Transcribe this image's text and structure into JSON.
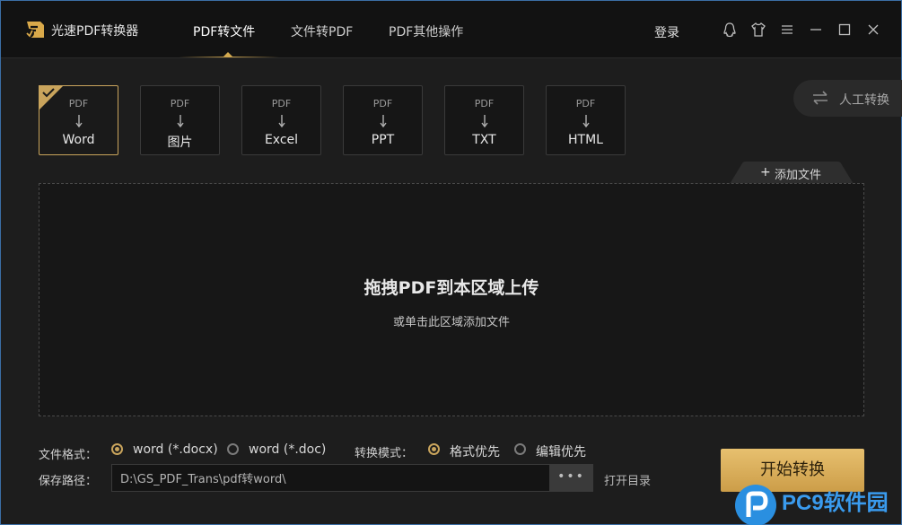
{
  "app": {
    "title": "光速PDF转换器",
    "login": "登录",
    "nav_tabs": [
      "PDF转文件",
      "文件转PDF",
      "PDF其他操作"
    ],
    "window_icons": [
      "qq-icon",
      "skin-icon",
      "menu-icon",
      "minimize-icon",
      "maximize-icon",
      "close-icon"
    ]
  },
  "formats": [
    {
      "from": "PDF",
      "to": "Word",
      "selected": true
    },
    {
      "from": "PDF",
      "to": "图片",
      "selected": false
    },
    {
      "from": "PDF",
      "to": "Excel",
      "selected": false
    },
    {
      "from": "PDF",
      "to": "PPT",
      "selected": false
    },
    {
      "from": "PDF",
      "to": "TXT",
      "selected": false
    },
    {
      "from": "PDF",
      "to": "HTML",
      "selected": false
    }
  ],
  "manual_convert": "人工转换",
  "add_file": "添加文件",
  "dropzone": {
    "title": "拖拽PDF到本区域上传",
    "subtitle": "或单击此区域添加文件"
  },
  "options": {
    "format_label": "文件格式：",
    "format_options": [
      "word (*.docx)",
      "word (*.doc)"
    ],
    "format_selected": "word (*.docx)",
    "mode_label": "转换模式：",
    "mode_options": [
      "格式优先",
      "编辑优先"
    ],
    "mode_selected": "格式优先",
    "save_label": "保存路径：",
    "save_path": "D:\\GS_PDF_Trans\\pdf转word\\",
    "browse": "•••",
    "open_dir": "打开目录"
  },
  "start_button": "开始转换",
  "watermark": "PC9软件园",
  "colors": {
    "accent_gold": "#c9a45c",
    "background": "#1d1d1d",
    "watermark_blue": "#2a8fe0"
  }
}
